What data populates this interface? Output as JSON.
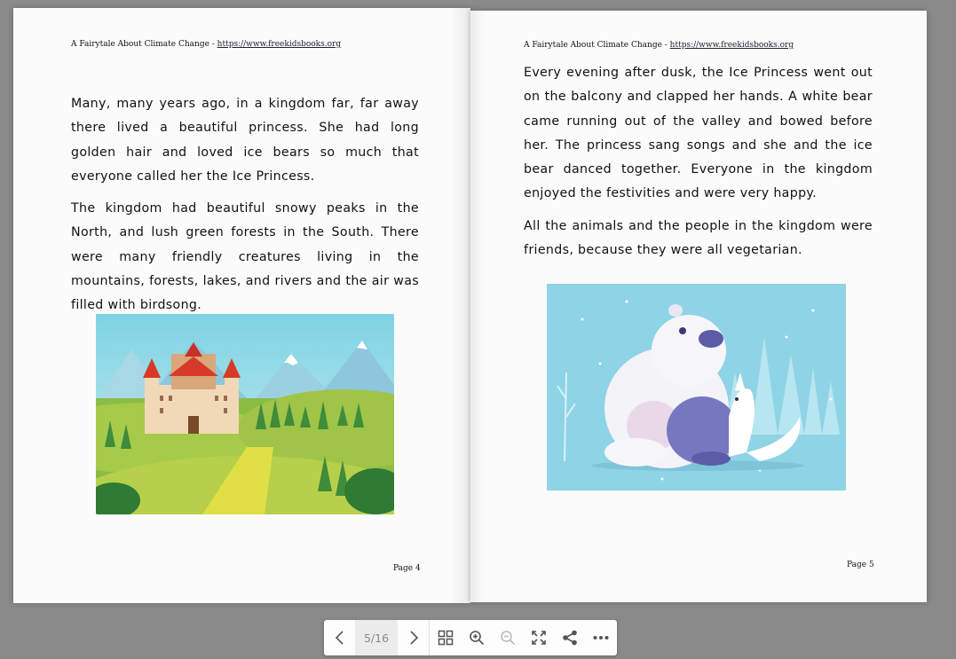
{
  "left_page": {
    "running_head_title": "A Fairytale About Climate Change - ",
    "running_head_url": "https://www.freekidsbooks.org",
    "paragraphs": [
      "Many, many years ago, in a kingdom far, far away there lived a beautiful princess. She had long golden hair and loved ice bears so much that everyone called her the Ice Princess.",
      "The kingdom had beautiful snowy peaks in the North, and lush green forests in the South. There were many friendly creatures living in the mountains, forests, lakes, and rivers and the air was filled with birdsong."
    ],
    "folio": "Page 4",
    "illustration": "castle-landscape"
  },
  "right_page": {
    "running_head_title": "A Fairytale About Climate Change - ",
    "running_head_url": "https://www.freekidsbooks.org",
    "paragraphs": [
      "Every evening after dusk, the Ice Princess went out on the balcony and clapped her hands. A white bear came running out of the valley and bowed before her. The princess sang songs and she and the ice bear danced together. Everyone in the kingdom enjoyed the festivities and were very happy.",
      "All the animals and the people in the kingdom were friends, because they were all vegetarian."
    ],
    "folio": "Page 5",
    "illustration": "polar-bear-and-fox"
  },
  "toolbar": {
    "page_indicator": "5/16",
    "icons": [
      "chevron-left-icon",
      "chevron-right-icon",
      "grid-icon",
      "zoom-in-icon",
      "zoom-out-icon",
      "fullscreen-icon",
      "share-icon",
      "more-icon"
    ],
    "icon_color": "#555555",
    "disabled_color": "#bbbbbb"
  }
}
